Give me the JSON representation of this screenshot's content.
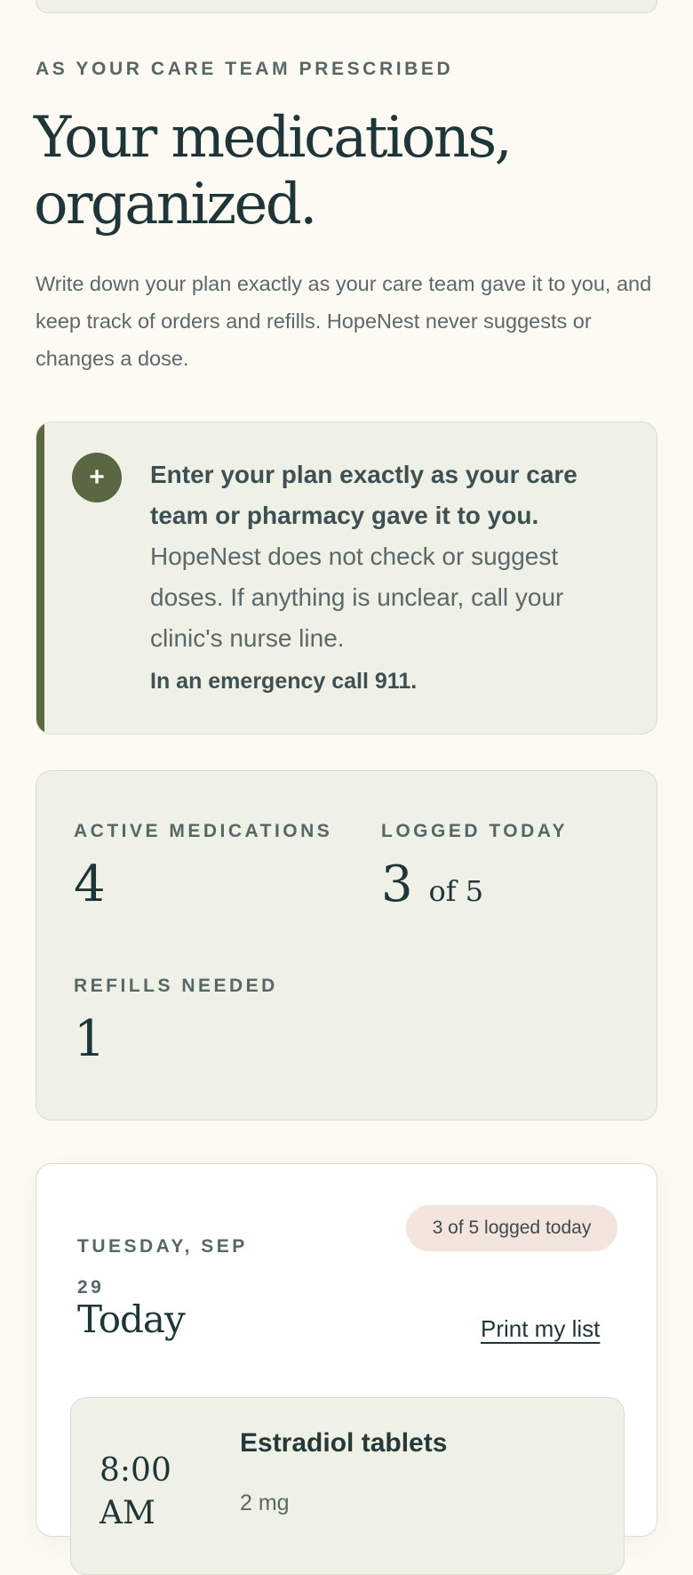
{
  "header": {
    "eyebrow": "AS YOUR CARE TEAM PRESCRIBED",
    "title": "Your medications, organized.",
    "lead": "Write down your plan exactly as your care team gave it to you, and keep track of orders and refills. HopeNest never suggests or changes a dose."
  },
  "note": {
    "icon": "plus-icon",
    "bold": "Enter your plan exactly as your care team or pharmacy gave it to you.",
    "body": " HopeNest does not check or suggest doses. If anything is unclear, call your clinic's nurse line.",
    "emergency": "In an emergency call 911."
  },
  "stats": {
    "active_label": "ACTIVE MEDICATIONS",
    "active_value": "4",
    "logged_label": "LOGGED TODAY",
    "logged_value": "3",
    "logged_of": "of 5",
    "refills_label": "REFILLS NEEDED",
    "refills_value": "1"
  },
  "today": {
    "date": "TUESDAY, SEP 29",
    "badge": "3 of 5 logged today",
    "title": "Today",
    "print_label": "Print my list",
    "medications": [
      {
        "time": "8:00 AM",
        "name": "Estradiol tablets",
        "dose": "2 mg"
      }
    ]
  },
  "colors": {
    "background": "#fdfaf4",
    "accent": "#5b6643",
    "card": "#eff0e6",
    "badge": "#f3e5de",
    "ink": "#1f3638"
  }
}
